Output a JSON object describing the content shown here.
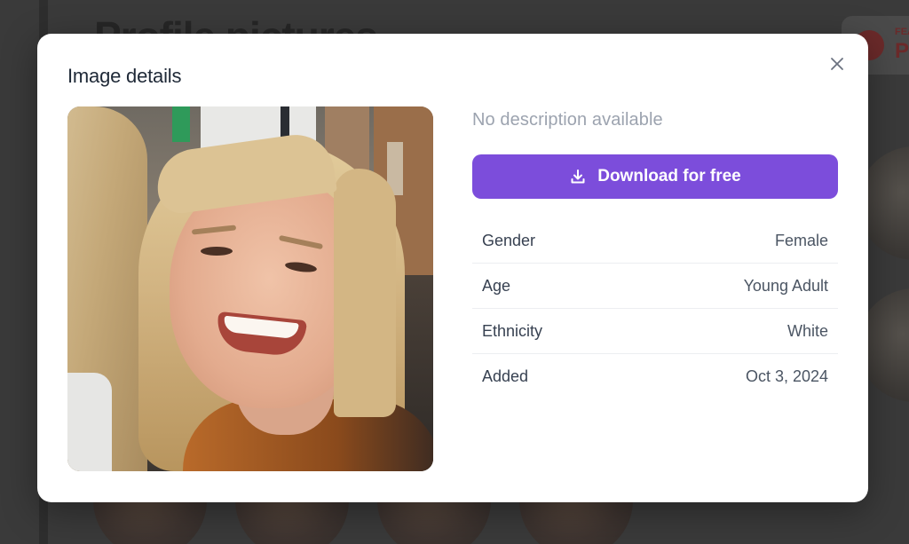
{
  "background": {
    "page_title": "Profile pictures",
    "card_label_small": "FEAT",
    "card_label_big": "P"
  },
  "modal": {
    "title": "Image details",
    "close_icon": "close-icon",
    "description": "No description available",
    "download_label": "Download for free",
    "download_icon": "download-icon",
    "details": [
      {
        "label": "Gender",
        "value": "Female"
      },
      {
        "label": "Age",
        "value": "Young Adult"
      },
      {
        "label": "Ethnicity",
        "value": "White"
      },
      {
        "label": "Added",
        "value": "Oct 3, 2024"
      }
    ]
  },
  "colors": {
    "accent": "#7c4ddb",
    "overlay": "#3a3a3a",
    "modal_bg": "#ffffff",
    "muted_text": "#9ca3af"
  }
}
